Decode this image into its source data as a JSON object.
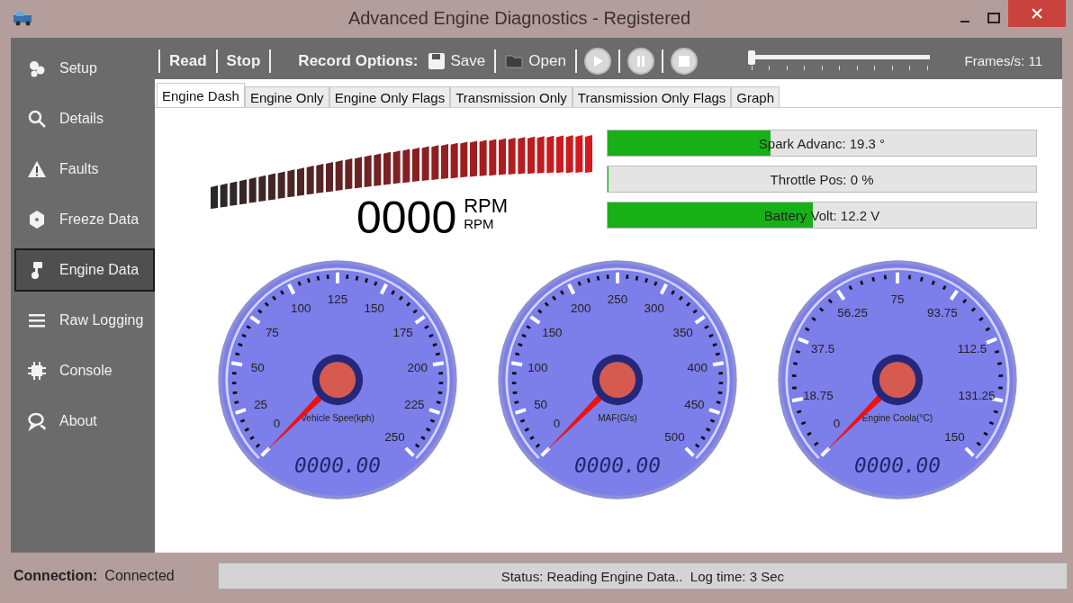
{
  "window": {
    "title": "Advanced Engine Diagnostics - Registered"
  },
  "sidebar": {
    "items": [
      {
        "label": "Setup",
        "selected": false
      },
      {
        "label": "Details",
        "selected": false
      },
      {
        "label": "Faults",
        "selected": false
      },
      {
        "label": "Freeze Data",
        "selected": false
      },
      {
        "label": "Engine Data",
        "selected": true
      },
      {
        "label": "Raw Logging",
        "selected": false
      },
      {
        "label": "Console",
        "selected": false
      },
      {
        "label": "About",
        "selected": false
      }
    ]
  },
  "toolbar": {
    "read": "Read",
    "stop": "Stop",
    "record_label": "Record Options:",
    "save": "Save",
    "open": "Open",
    "playback_slider": {
      "level": 0
    },
    "frames": "Frames/s: 11"
  },
  "tabs": [
    {
      "label": "Engine Dash",
      "selected": true
    },
    {
      "label": "Engine Only",
      "selected": false
    },
    {
      "label": "Engine Only Flags",
      "selected": false
    },
    {
      "label": "Transmission Only",
      "selected": false
    },
    {
      "label": "Transmission Only Flags",
      "selected": false
    },
    {
      "label": "Graph",
      "selected": false
    }
  ],
  "tachometer": {
    "reading": "0000",
    "unit": "RPM",
    "unit_small": "RPM"
  },
  "meters": [
    {
      "label": "Spark Advanc: 19.3 °",
      "level": 0.38
    },
    {
      "label": "Throttle Pos: 0 %",
      "level": 0
    },
    {
      "label": "Battery Volt: 12.2 V",
      "level": 0.48
    }
  ],
  "gauges": [
    {
      "label": "Vehicle Spee(kph)",
      "ticks": [
        "0",
        "25",
        "50",
        "75",
        "100",
        "125",
        "150",
        "175",
        "200",
        "225",
        "250"
      ],
      "readout": "0000.00"
    },
    {
      "label": "MAF(G/s)",
      "ticks": [
        "0",
        "50",
        "100",
        "150",
        "200",
        "250",
        "300",
        "350",
        "400",
        "450",
        "500"
      ],
      "readout": "0000.00"
    },
    {
      "label": "Engine Coola(°C)",
      "ticks": [
        "0",
        "18.75",
        "37.5",
        "56.25",
        "75",
        "93.75",
        "112.5",
        "131.25",
        "150"
      ],
      "readout": "0000.00"
    }
  ],
  "status_bar": {
    "connection_label": "Connection:",
    "connection": "Connected",
    "status": "Status: Reading Engine Data..  Log time: 3 Sec"
  }
}
